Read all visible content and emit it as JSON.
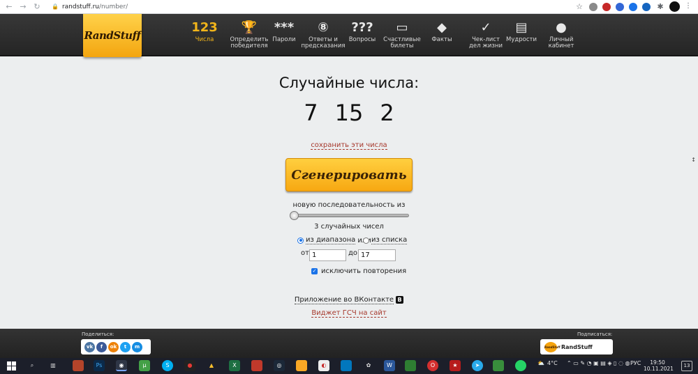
{
  "browser": {
    "domain": "randstuff.ru",
    "path": "/number/"
  },
  "site": {
    "logo_text": "RandStuff",
    "nav": [
      {
        "icon_text": "123",
        "label_lines": [
          "Числа",
          ""
        ],
        "icon": "numbers-icon",
        "active": true
      },
      {
        "icon_text": "🏆",
        "label_lines": [
          "Определить",
          "победителя"
        ],
        "icon": "trophy-icon"
      },
      {
        "icon_text": "***",
        "label_lines": [
          "Пароли",
          ""
        ],
        "icon": "password-icon"
      },
      {
        "icon_text": "⑧",
        "label_lines": [
          "Ответы и",
          "предсказания"
        ],
        "icon": "magic-ball-icon"
      },
      {
        "icon_text": "???",
        "label_lines": [
          "Вопросы",
          ""
        ],
        "icon": "questions-icon"
      },
      {
        "icon_text": "▭",
        "label_lines": [
          "Счастливые",
          "билеты"
        ],
        "icon": "ticket-icon"
      },
      {
        "icon_text": "◆",
        "label_lines": [
          "Факты",
          ""
        ],
        "icon": "facts-icon"
      },
      {
        "icon_text": "✓",
        "label_lines": [
          "Чек-лист",
          "дел жизни"
        ],
        "icon": "checklist-icon"
      },
      {
        "icon_text": "▤",
        "label_lines": [
          "Мудрости",
          ""
        ],
        "icon": "wisdom-icon"
      },
      {
        "icon_text": "●",
        "label_lines": [
          "Личный",
          "кабинет"
        ],
        "icon": "user-icon"
      }
    ]
  },
  "main": {
    "title": "Случайные числа:",
    "numbers": [
      "7",
      "15",
      "2"
    ],
    "save_link": "сохранить эти числа",
    "generate_button": "Сгенерировать",
    "new_sequence_label": "новую последовательность из",
    "count_label": "3 случайных чисел",
    "count_fraction": 0.0,
    "mode_range": "из диапазона",
    "mode_or": "или",
    "mode_list": "из списка",
    "from_label": "от",
    "from_value": "1",
    "to_label": "до",
    "to_value": "17",
    "exclude_repeats": "исключить повторения",
    "vk_app": "Приложение во ВКонтакте",
    "vk_badge": "В",
    "widget_link": "Виджет ГСЧ на сайт"
  },
  "footer": {
    "share_label": "Поделиться:",
    "share_buttons": [
      {
        "text": "vk",
        "color": "#4c75a3"
      },
      {
        "text": "f",
        "color": "#3b5998"
      },
      {
        "text": "ok",
        "color": "#ee8208"
      },
      {
        "text": "t",
        "color": "#1da1f2"
      },
      {
        "text": "m",
        "color": "#168de2"
      }
    ],
    "subscribe_label": "Подписаться:",
    "subscribe_logo": "RandStuff",
    "subscribe_name": "RandStuff"
  },
  "taskbar": {
    "weather": "4°C",
    "lang": "РУС",
    "time": "19:50",
    "date": "10.11.2021",
    "notifications": "13"
  },
  "colors": {
    "accent": "#f2b51a",
    "link": "#a6372b",
    "header": "#2e2e2e"
  }
}
